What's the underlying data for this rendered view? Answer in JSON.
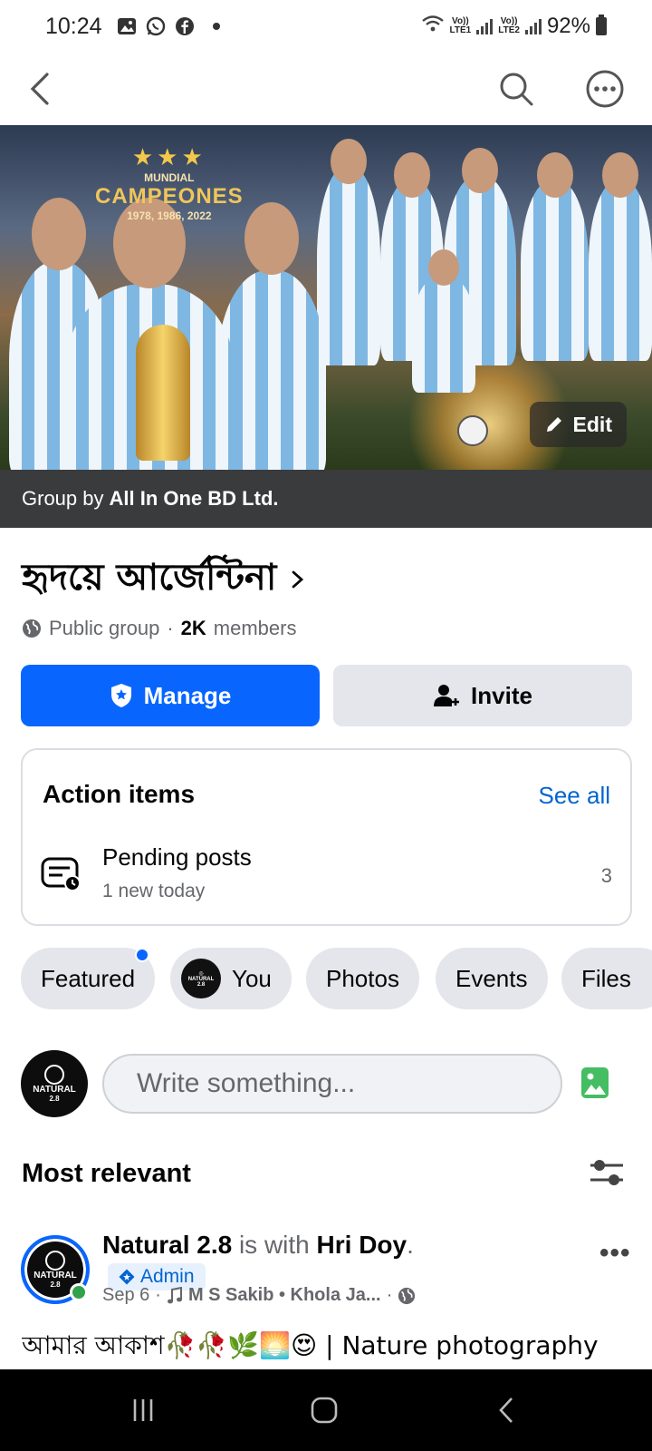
{
  "status_bar": {
    "time": "10:24",
    "net1": "Vo))\nLTE1",
    "net2": "Vo))\nLTE2",
    "battery": "92%"
  },
  "cover": {
    "title_small": "MUNDIAL",
    "title_big": "CAMPEONES",
    "years": "1978, 1986, 2022",
    "edit_label": "Edit"
  },
  "group_by": {
    "prefix": "Group by",
    "owner": "All In One BD Ltd."
  },
  "group": {
    "name": "হৃদয়ে আর্জেন্টিনা",
    "privacy": "Public group",
    "separator": "·",
    "member_count": "2K",
    "members_label": "members"
  },
  "buttons": {
    "manage": "Manage",
    "invite": "Invite"
  },
  "action_items": {
    "title": "Action items",
    "see_all": "See all",
    "item_title": "Pending posts",
    "item_subtitle": "1 new today",
    "item_count": "3"
  },
  "chips": {
    "featured": "Featured",
    "you": "You",
    "photos": "Photos",
    "events": "Events",
    "files": "Files"
  },
  "avatar": {
    "line1": "NATURAL",
    "line2": "2.8"
  },
  "composer": {
    "placeholder": "Write something..."
  },
  "feed": {
    "sort_label": "Most relevant"
  },
  "post": {
    "author": "Natural 2.8",
    "with_text": "is with",
    "tagged": "Hri Doy",
    "period": ".",
    "badge": "Admin",
    "date": "Sep 6",
    "music": "M S Sakib • Khola Ja...",
    "text": "আমার আকাশ🥀🥀🌿🌅😍 | Nature photography"
  },
  "colors": {
    "primary": "#0866ff",
    "link": "#0064d1",
    "chip_bg": "#e4e6eb",
    "secondary_text": "#65676b",
    "online": "#31a24c",
    "photo_green": "#45bd62"
  }
}
